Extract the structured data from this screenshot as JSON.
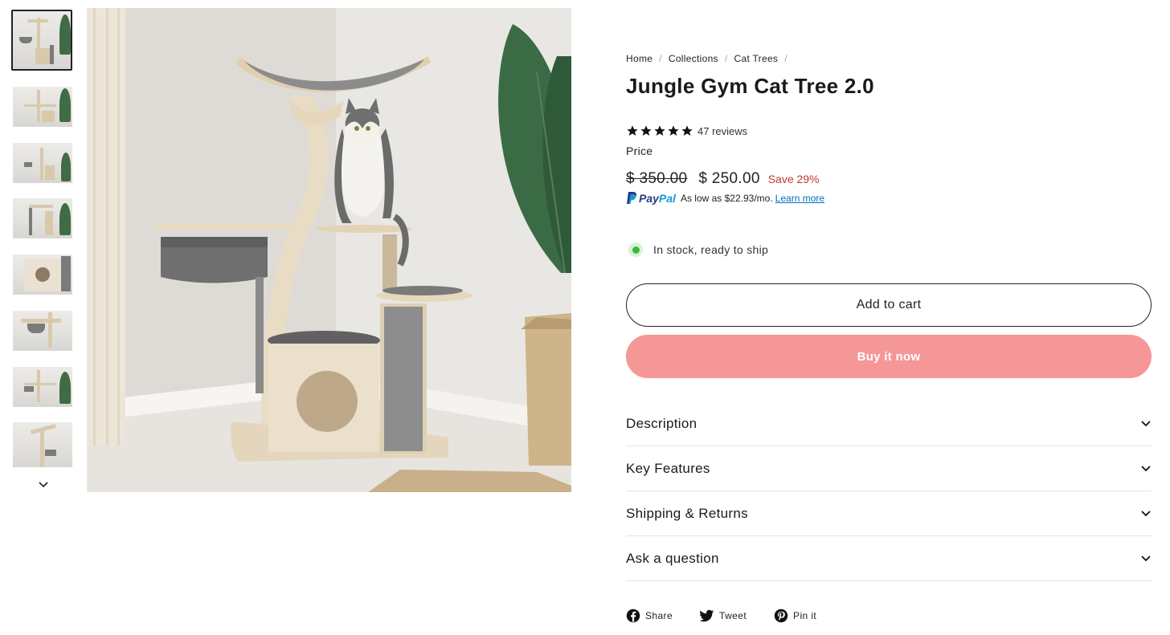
{
  "breadcrumb": [
    "Home",
    "Collections",
    "Cat Trees"
  ],
  "product": {
    "title": "Jungle Gym Cat Tree 2.0",
    "rating_stars": 5,
    "reviews": "47 reviews",
    "price_label": "Price",
    "compare_price": "$ 350.00",
    "sale_price": "$ 250.00",
    "save_text": "Save 29%"
  },
  "paypal": {
    "logo_text_1": "Pay",
    "logo_text_2": "Pal",
    "message": "As low as $22.93/mo.",
    "link": "Learn more"
  },
  "stock": "In stock, ready to ship",
  "buttons": {
    "add_to_cart": "Add to cart",
    "buy_now": "Buy it now"
  },
  "accordion": [
    "Description",
    "Key Features",
    "Shipping & Returns",
    "Ask a question"
  ],
  "social": [
    "Share",
    "Tweet",
    "Pin it"
  ],
  "colors": {
    "buy_button": "#f59796",
    "save_red": "#c0392b",
    "stock_green": "#3cba3c",
    "paypal_blue": "#253b80",
    "paypal_light_blue": "#179bd7"
  },
  "thumbnails_count": 8
}
